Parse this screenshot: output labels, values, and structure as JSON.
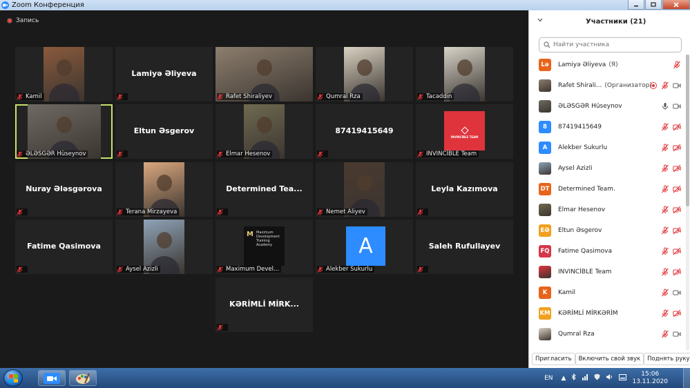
{
  "window": {
    "title": "Zoom Конференция"
  },
  "recording": {
    "label": "Запись"
  },
  "tiles": [
    {
      "name": "Kamil",
      "photo": true,
      "photo_color": "#8a5a3c"
    },
    {
      "name": "Lamiyə Əliyeva",
      "photo": false
    },
    {
      "name": "Rafet Shiraliyev",
      "photo": true,
      "photo_color": "#8d7e6e"
    },
    {
      "name": "Qumral Rza",
      "photo": true,
      "photo_color": "#d9d2c2"
    },
    {
      "name": "Tacəddin",
      "photo": true,
      "photo_color": "#d7d3c8"
    },
    {
      "name": "ƏLƏSGƏR Hüseynov",
      "photo": true,
      "photo_color": "#6e6a63",
      "active": true
    },
    {
      "name": "Eltun Əsgerov",
      "photo": false
    },
    {
      "name": "Elmar Hesenov",
      "photo": true,
      "photo_color": "#6f6a4f"
    },
    {
      "name": "87419415649",
      "photo": false
    },
    {
      "name": "INVINCİBLE Team",
      "photo": true,
      "photo_color": "#e0343d"
    },
    {
      "name": "Nuray Ələsgərova",
      "photo": false
    },
    {
      "name": "Terana Mirzayeva",
      "photo": true,
      "photo_color": "#d9a77e"
    },
    {
      "name": "Determined  Tea...",
      "photo": false
    },
    {
      "name": "Nemet Aliyev",
      "photo": true,
      "photo_color": "#4a3a30"
    },
    {
      "name": "Leyla Kazımova",
      "photo": false
    },
    {
      "name": "Fatime Qasimova",
      "photo": false
    },
    {
      "name": "Aysel Azizli",
      "photo": true,
      "photo_color": "#8fa3b8"
    },
    {
      "name": "Maximum Devel...",
      "photo": true,
      "photo_color": "#161616"
    },
    {
      "name": "Alekber Sukurlu",
      "photo": false,
      "avatar_letter": "A"
    },
    {
      "name": "Saleh Rufullayev",
      "photo": false
    },
    {
      "name": "KƏRİMLİ MİRK...",
      "photo": false
    }
  ],
  "tile_logo_text": {
    "invincible": "INVINCİBLE TEAM",
    "maximum": "Maximum Development Training Academy"
  },
  "participants": {
    "title": "Участники (21)",
    "search_placeholder": "Найти участника",
    "items": [
      {
        "initials": "Lə",
        "color": "#e8641b",
        "name": "Lamiyə Əliyeva",
        "role": "(Я)",
        "mic": "muted",
        "video": "none"
      },
      {
        "initials": "",
        "color": "#8d7e6e",
        "name": "Rafet Shirali...",
        "role": "(Организатор)",
        "recording": true,
        "mic": "muted",
        "video": "on"
      },
      {
        "initials": "",
        "color": "#6e6a63",
        "name": "ƏLƏSGƏR Hüseynov",
        "role": "",
        "mic": "on",
        "video": "on"
      },
      {
        "initials": "8",
        "color": "#2d8cff",
        "name": "87419415649",
        "role": "",
        "mic": "muted",
        "video": "off"
      },
      {
        "initials": "A",
        "color": "#2d8cff",
        "name": "Alekber Sukurlu",
        "role": "",
        "mic": "muted",
        "video": "off"
      },
      {
        "initials": "",
        "color": "#8fa3b8",
        "name": "Aysel Azizli",
        "role": "",
        "mic": "muted",
        "video": "off"
      },
      {
        "initials": "DT",
        "color": "#e8641b",
        "name": "Determined Team.",
        "role": "",
        "mic": "muted",
        "video": "off"
      },
      {
        "initials": "",
        "color": "#6f6a4f",
        "name": "Elmar Hesenov",
        "role": "",
        "mic": "muted",
        "video": "off"
      },
      {
        "initials": "EƏ",
        "color": "#f0a01e",
        "name": "Eltun Əsgerov",
        "role": "",
        "mic": "muted",
        "video": "off"
      },
      {
        "initials": "FQ",
        "color": "#d6364a",
        "name": "Fatime Qasimova",
        "role": "",
        "mic": "muted",
        "video": "off"
      },
      {
        "initials": "",
        "color": "#e0343d",
        "name": "INVINCİBLE Team",
        "role": "",
        "mic": "muted",
        "video": "off"
      },
      {
        "initials": "K",
        "color": "#e8641b",
        "name": "Kamil",
        "role": "",
        "mic": "muted",
        "video": "on"
      },
      {
        "initials": "KM",
        "color": "#f0a01e",
        "name": "KƏRİMLİ MİRKƏRİM",
        "role": "",
        "mic": "muted",
        "video": "off"
      },
      {
        "initials": "",
        "color": "#d9d2c2",
        "name": "Qumral Rza",
        "role": "",
        "mic": "muted",
        "video": "on"
      }
    ],
    "footer": {
      "invite": "Пригласить",
      "unmute": "Включить свой звук",
      "raise_hand": "Поднять руку"
    }
  },
  "taskbar": {
    "language": "EN",
    "time": "15:06",
    "date": "13.11.2020"
  },
  "colors": {
    "accent": "#2d8cff",
    "active_border": "#c7e36b",
    "muted_red": "#e0373b"
  }
}
